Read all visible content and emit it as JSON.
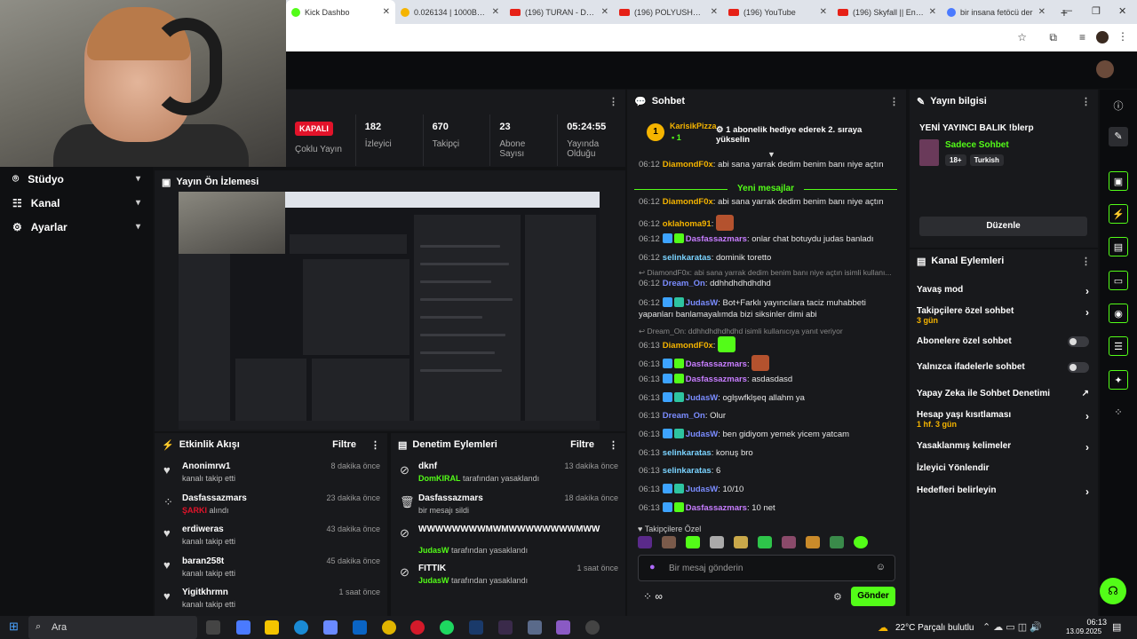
{
  "browser": {
    "tabs": [
      {
        "label": "Kick Dashbo",
        "active": true
      },
      {
        "label": "0.026134 | 1000BON"
      },
      {
        "label": "(196) TURAN - DOM"
      },
      {
        "label": "(196) POLYUSHKA PO"
      },
      {
        "label": "(196) YouTube"
      },
      {
        "label": "(196) Skyfall || Enjoy"
      },
      {
        "label": "bir insana fetöcü der"
      }
    ],
    "new_tab": "+"
  },
  "sidebar": {
    "items": [
      {
        "label": "Stüdyo",
        "icon": "studio-icon"
      },
      {
        "label": "Kanal",
        "icon": "channel-icon"
      },
      {
        "label": "Ayarlar",
        "icon": "gear-icon"
      }
    ]
  },
  "stats": {
    "status": "KAPALI",
    "multi_stream": "Çoklu Yayın",
    "items": [
      {
        "value": "182",
        "label": "İzleyici"
      },
      {
        "value": "670",
        "label": "Takipçi"
      },
      {
        "value": "23",
        "label": "Abone Sayısı"
      },
      {
        "value": "05:24:55",
        "label": "Yayında Olduğu"
      }
    ]
  },
  "preview": {
    "title": "Yayın Ön İzlemesi"
  },
  "activity": {
    "title": "Etkinlik Akışı",
    "filter": "Filtre",
    "items": [
      {
        "name": "Anonimrw1",
        "sub": "kanalı takip etti",
        "time": "8 dakika önce",
        "icon": "heart-icon"
      },
      {
        "name": "Dasfassazmars",
        "sub_hl": "ŞARKI",
        "sub": "alındı",
        "time": "23 dakika önce",
        "icon": "dots-icon"
      },
      {
        "name": "erdiweras",
        "sub": "kanalı takip etti",
        "time": "43 dakika önce",
        "icon": "heart-icon"
      },
      {
        "name": "baran258t",
        "sub": "kanalı takip etti",
        "time": "45 dakika önce",
        "icon": "heart-icon"
      },
      {
        "name": "Yigitkhrmn",
        "sub": "kanalı takip etti",
        "time": "1 saat önce",
        "icon": "heart-icon"
      }
    ]
  },
  "modlog": {
    "title": "Denetim Eylemleri",
    "filter": "Filtre",
    "items": [
      {
        "name": "dknf",
        "by": "DomKIRAL",
        "sub": "tarafından yasaklandı",
        "time": "13 dakika önce",
        "icon": "ban-icon"
      },
      {
        "name": "Dasfassazmars",
        "sub": "bir mesajı sildi",
        "time": "18 dakika önce",
        "icon": "trash-icon"
      },
      {
        "name": "WWWWWWWWMWMWWWWWWWWMWW",
        "by": "JudasW",
        "sub": "tarafından yasaklandı",
        "time": "",
        "icon": "ban-icon"
      },
      {
        "name": "FITTIK",
        "by": "JudasW",
        "sub": "tarafından yasaklandı",
        "time": "1 saat önce",
        "icon": "ban-icon"
      }
    ]
  },
  "chat": {
    "title": "Sohbet",
    "pinned": {
      "user": "KarisikPizza",
      "count": "1",
      "rank": "1",
      "text": "1 abonelik hediye ederek 2. sıraya yükselin"
    },
    "new_messages": "Yeni mesajlar",
    "messages": [
      {
        "time": "06:12",
        "user": "DiamondF0x",
        "color": "#f5b400",
        "text": "abi sana yarrak dedim benim banı niye açtın"
      },
      {
        "time": "06:12",
        "user": "DiamondF0x",
        "color": "#f5b400",
        "text": "abi sana yarrak dedim benim banı niye açtın"
      },
      {
        "time": "06:12",
        "user": "oklahoma91",
        "color": "#f5b400",
        "text": "",
        "emote": "#b4522e"
      },
      {
        "time": "06:12",
        "user": "Dasfassazmars",
        "color": "#c77dff",
        "text": "onlar chat botuydu judas banladı",
        "badges": [
          "#3da3ff",
          "#53fc18"
        ]
      },
      {
        "time": "06:12",
        "user": "selinkaratas",
        "color": "#7ad3ff",
        "text": "dominik toretto"
      },
      {
        "reply": "DiamondF0x: abi sana yarrak dedim benim banı niye açtın isimli kullanı..."
      },
      {
        "time": "06:12",
        "user": "Dream_On",
        "color": "#7a8cff",
        "text": "ddhhdhdhdhdhd"
      },
      {
        "time": "06:12",
        "user": "JudasW",
        "color": "#7a8cff",
        "text": "Bot+Farklı yayıncılara taciz muhabbeti yapanları banlamayalımda bizi siksinler dimi abi",
        "badges": [
          "#3da3ff",
          "#2ec4a0"
        ]
      },
      {
        "reply": "Dream_On: ddhhdhdhdhdhd isimli kullanıcıya yanıt veriyor"
      },
      {
        "time": "06:13",
        "user": "DiamondF0x",
        "color": "#f5b400",
        "text": "",
        "emote": "#53fc18"
      },
      {
        "time": "06:13",
        "user": "Dasfassazmars",
        "color": "#c77dff",
        "text": "",
        "emote": "#b4522e",
        "badges": [
          "#3da3ff",
          "#53fc18"
        ]
      },
      {
        "time": "06:13",
        "user": "Dasfassazmars",
        "color": "#c77dff",
        "text": "asdasdasd",
        "badges": [
          "#3da3ff",
          "#53fc18"
        ]
      },
      {
        "time": "06:13",
        "user": "JudasW",
        "color": "#7a8cff",
        "text": "oglşwfklşeq allahm ya",
        "badges": [
          "#3da3ff",
          "#2ec4a0"
        ]
      },
      {
        "time": "06:13",
        "user": "Dream_On",
        "color": "#7a8cff",
        "text": "Olur"
      },
      {
        "time": "06:13",
        "user": "JudasW",
        "color": "#7a8cff",
        "text": "ben gidiyom yemek yicem yatcam",
        "badges": [
          "#3da3ff",
          "#2ec4a0"
        ]
      },
      {
        "time": "06:13",
        "user": "selinkaratas",
        "color": "#7ad3ff",
        "text": "konuş bro"
      },
      {
        "time": "06:13",
        "user": "selinkaratas",
        "color": "#7ad3ff",
        "text": "6"
      },
      {
        "time": "06:13",
        "user": "JudasW",
        "color": "#7a8cff",
        "text": "10/10",
        "badges": [
          "#3da3ff",
          "#2ec4a0"
        ]
      },
      {
        "time": "06:13",
        "user": "Dasfassazmars",
        "color": "#c77dff",
        "text": "10 net",
        "badges": [
          "#3da3ff",
          "#53fc18"
        ]
      }
    ],
    "followers_only": "Takipçilere Özel",
    "input_placeholder": "Bir mesaj gönderin",
    "send": "Gönder"
  },
  "info": {
    "title": "Yayın bilgisi",
    "stream_title": "YENİ YAYINCI BALIK !blerp",
    "category": "Sadece Sohbet",
    "tags": [
      "18+",
      "Turkish"
    ],
    "edit": "Düzenle"
  },
  "actions": {
    "title": "Kanal Eylemleri",
    "items": [
      {
        "label": "Yavaş mod",
        "type": "chevron"
      },
      {
        "label": "Takipçilere özel sohbet",
        "sub": "3 gün",
        "type": "chevron"
      },
      {
        "label": "Abonelere özel sohbet",
        "type": "toggle"
      },
      {
        "label": "Yalnızca ifadelerle sohbet",
        "type": "toggle"
      },
      {
        "label": "Yapay Zeka ile Sohbet Denetimi",
        "type": "external"
      },
      {
        "label": "Hesap yaşı kısıtlaması",
        "sub": "1 hf. 3 gün",
        "type": "chevron"
      },
      {
        "label": "Yasaklanmış kelimeler",
        "type": "chevron"
      },
      {
        "label": "İzleyici Yönlendir",
        "type": "none"
      },
      {
        "label": "Hedefleri belirleyin",
        "type": "chevron"
      }
    ]
  },
  "taskbar": {
    "search": "Ara",
    "weather": "22°C  Parçalı bulutlu",
    "time": "06:13",
    "date": "13.09.2025"
  }
}
